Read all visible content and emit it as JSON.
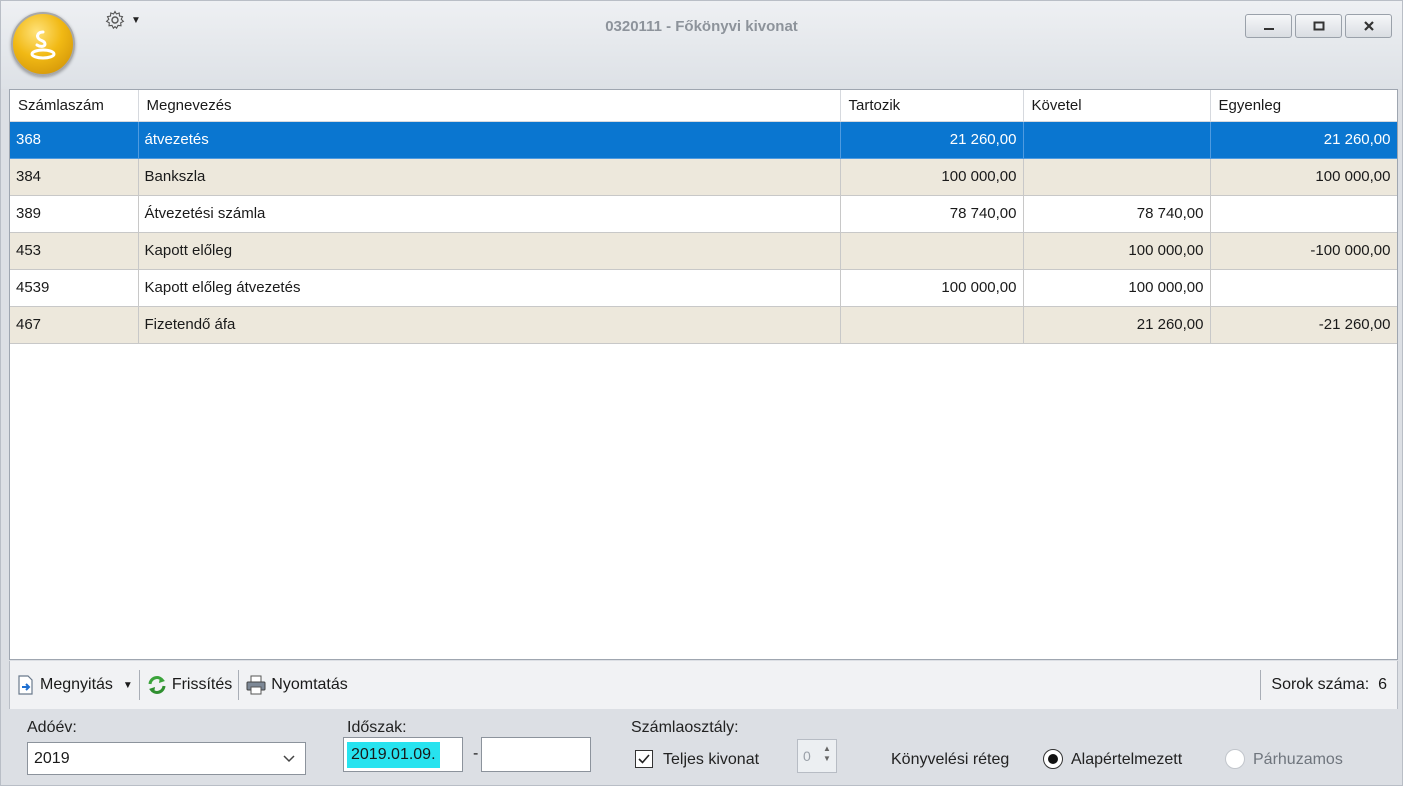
{
  "window": {
    "title": "0320111 - Főkönyvi kivonat",
    "controls": [
      "minimize",
      "maximize",
      "close"
    ]
  },
  "icons": {
    "app_orb": "snake-logo-icon",
    "settings": "gear-icon",
    "open": "document-open-icon",
    "refresh": "refresh-icon",
    "print": "printer-icon"
  },
  "grid": {
    "columns": [
      "Számlaszám",
      "Megnevezés",
      "Tartozik",
      "Követel",
      "Egyenleg"
    ],
    "rows": [
      {
        "szamlaszam": "368",
        "megnevezes": "átvezetés",
        "tartozik": "21 260,00",
        "kovetel": "",
        "egyenleg": "21 260,00",
        "selected": true
      },
      {
        "szamlaszam": "384",
        "megnevezes": "Bankszla",
        "tartozik": "100 000,00",
        "kovetel": "",
        "egyenleg": "100 000,00"
      },
      {
        "szamlaszam": "389",
        "megnevezes": "Átvezetési számla",
        "tartozik": "78 740,00",
        "kovetel": "78 740,00",
        "egyenleg": ""
      },
      {
        "szamlaszam": "453",
        "megnevezes": "Kapott előleg",
        "tartozik": "",
        "kovetel": "100 000,00",
        "egyenleg": "-100 000,00"
      },
      {
        "szamlaszam": "4539",
        "megnevezes": "Kapott előleg átvezetés",
        "tartozik": "100 000,00",
        "kovetel": "100 000,00",
        "egyenleg": ""
      },
      {
        "szamlaszam": "467",
        "megnevezes": "Fizetendő áfa",
        "tartozik": "",
        "kovetel": "21 260,00",
        "egyenleg": "-21 260,00"
      }
    ],
    "selected_color": "#0a76d0",
    "alt_row_color": "#ede8dc"
  },
  "toolbar": {
    "open_label": "Megnyitás",
    "refresh_label": "Frissítés",
    "print_label": "Nyomtatás",
    "rows_count_label": "Sorok száma:",
    "rows_count": "6"
  },
  "filters": {
    "year_label": "Adóév:",
    "year_value": "2019",
    "period_label": "Időszak:",
    "period_from": "2019.01.09.",
    "period_to": "",
    "period_separator": "-",
    "class_label": "Számlaosztály:",
    "full_statement_label": "Teljes kivonat",
    "full_statement_checked": true,
    "class_value": "0",
    "layer_label": "Könyvelési réteg",
    "layer_options": [
      "Alapértelmezett",
      "Párhuzamos"
    ],
    "layer_selected": "Alapértelmezett"
  }
}
